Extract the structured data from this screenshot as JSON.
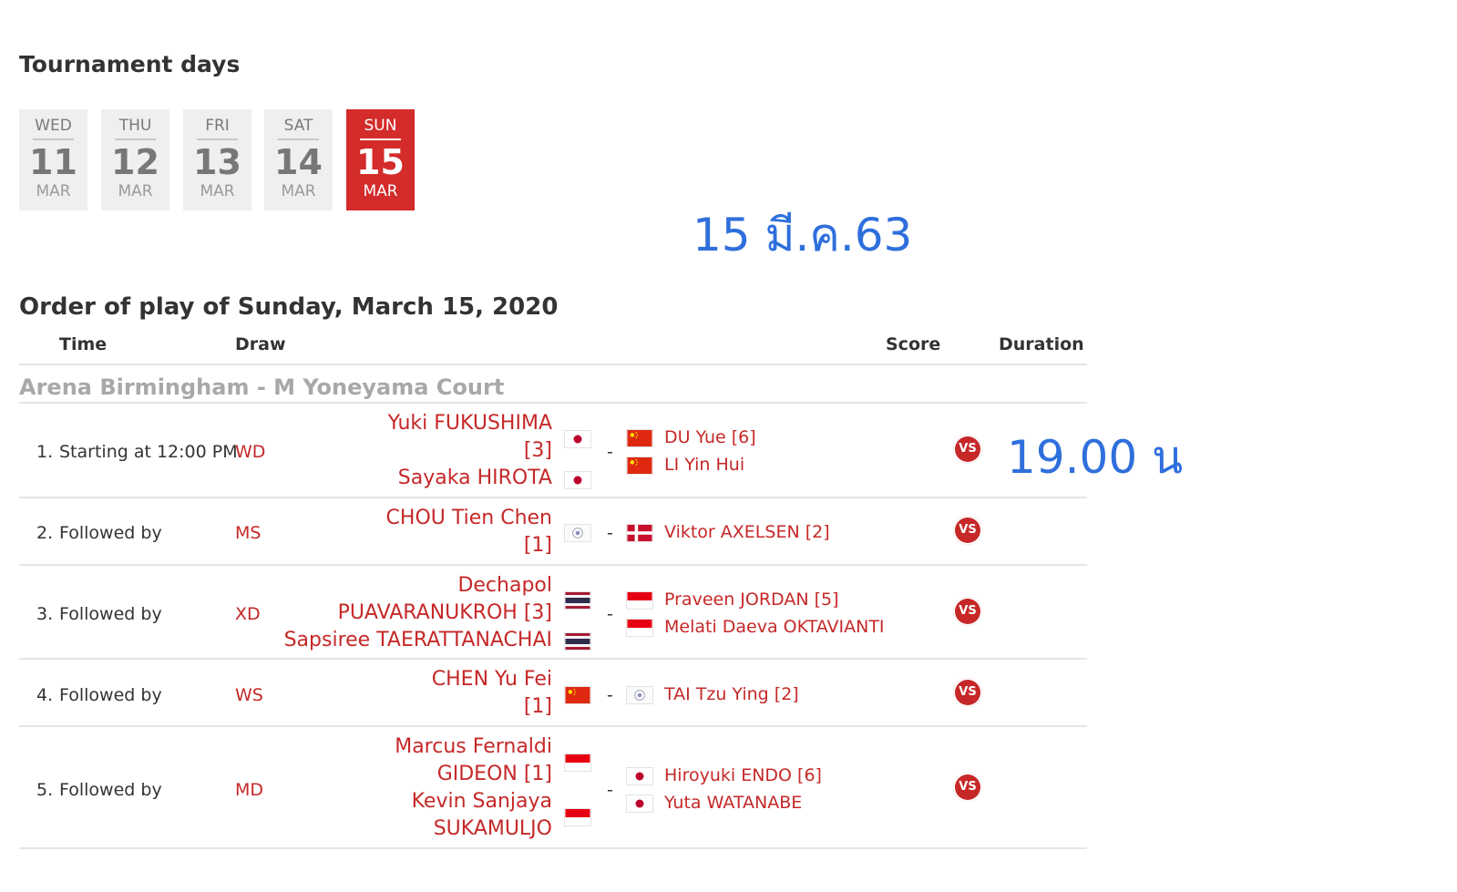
{
  "tournament_days_title": "Tournament days",
  "days": [
    {
      "dow": "WED",
      "num": "11",
      "mon": "MAR"
    },
    {
      "dow": "THU",
      "num": "12",
      "mon": "MAR"
    },
    {
      "dow": "FRI",
      "num": "13",
      "mon": "MAR"
    },
    {
      "dow": "SAT",
      "num": "14",
      "mon": "MAR"
    },
    {
      "dow": "SUN",
      "num": "15",
      "mon": "MAR",
      "active": true
    }
  ],
  "annotations": {
    "date": "15 มี.ค.63",
    "time": "19.00 น"
  },
  "order_title": "Order of play of Sunday, March 15, 2020",
  "columns": {
    "time": "Time",
    "draw": "Draw",
    "score": "Score",
    "duration": "Duration"
  },
  "court": "Arena Birmingham - M Yoneyama Court",
  "vs_label": "VS",
  "matches": [
    {
      "num": "1.",
      "time": "Starting at 12:00 PM",
      "draw": "WD",
      "left": [
        "Yuki FUKUSHIMA",
        "[3]",
        "Sayaka HIROTA"
      ],
      "left_flags": [
        "japan",
        "japan"
      ],
      "right": [
        "DU Yue [6]",
        "LI Yin Hui"
      ],
      "right_flags": [
        "china",
        "china"
      ]
    },
    {
      "num": "2.",
      "time": "Followed by",
      "draw": "MS",
      "left": [
        "CHOU Tien Chen",
        "[1]"
      ],
      "left_flags": [
        "chinese-taipei"
      ],
      "right": [
        "Viktor AXELSEN [2]"
      ],
      "right_flags": [
        "denmark"
      ]
    },
    {
      "num": "3.",
      "time": "Followed by",
      "draw": "XD",
      "left": [
        "Dechapol",
        "PUAVARANUKROH [3]",
        "Sapsiree TAERATTANACHAI"
      ],
      "left_flags": [
        "thailand",
        "thailand"
      ],
      "right": [
        "Praveen JORDAN [5]",
        "Melati Daeva OKTAVIANTI"
      ],
      "right_flags": [
        "indonesia",
        "indonesia"
      ]
    },
    {
      "num": "4.",
      "time": "Followed by",
      "draw": "WS",
      "left": [
        "CHEN Yu Fei",
        "[1]"
      ],
      "left_flags": [
        "china"
      ],
      "right": [
        "TAI Tzu Ying [2]"
      ],
      "right_flags": [
        "chinese-taipei"
      ]
    },
    {
      "num": "5.",
      "time": "Followed by",
      "draw": "MD",
      "left": [
        "Marcus Fernaldi",
        "GIDEON [1]",
        "Kevin Sanjaya",
        "SUKAMULJO"
      ],
      "left_flags": [
        "indonesia",
        "indonesia"
      ],
      "right": [
        "Hiroyuki ENDO [6]",
        "Yuta WATANABE"
      ],
      "right_flags": [
        "japan",
        "japan"
      ]
    }
  ],
  "colors": {
    "accent": "#d42b2b",
    "link": "#c62828",
    "annotation": "#2f6fdc"
  }
}
